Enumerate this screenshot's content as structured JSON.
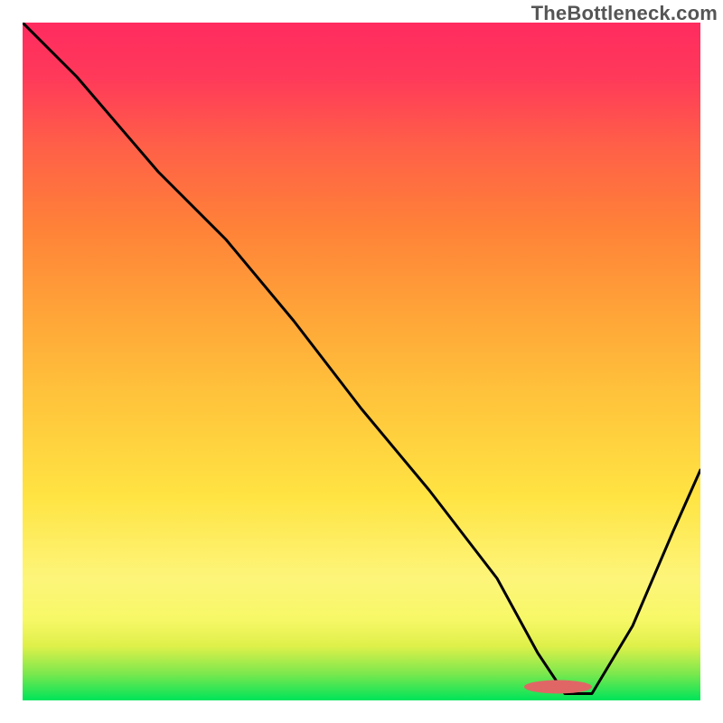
{
  "watermark": "TheBottleneck.com",
  "chart_data": {
    "type": "line",
    "title": "",
    "xlabel": "",
    "ylabel": "",
    "xlim": [
      0,
      100
    ],
    "ylim": [
      0,
      100
    ],
    "background": {
      "kind": "vertical-gradient",
      "description": "green at bottom through yellow/orange to pink at top",
      "stops": [
        {
          "pos": 0,
          "color": "#00e45a"
        },
        {
          "pos": 4,
          "color": "#7de84d"
        },
        {
          "pos": 8,
          "color": "#dff04a"
        },
        {
          "pos": 12,
          "color": "#f7f867"
        },
        {
          "pos": 18,
          "color": "#fdf57a"
        },
        {
          "pos": 30,
          "color": "#ffe443"
        },
        {
          "pos": 45,
          "color": "#ffc33b"
        },
        {
          "pos": 58,
          "color": "#ffa238"
        },
        {
          "pos": 70,
          "color": "#ff8138"
        },
        {
          "pos": 82,
          "color": "#ff5f48"
        },
        {
          "pos": 92,
          "color": "#ff395a"
        },
        {
          "pos": 100,
          "color": "#ff2b5f"
        }
      ]
    },
    "series": [
      {
        "name": "bottleneck-curve",
        "color": "#000000",
        "x": [
          0,
          8,
          20,
          30,
          40,
          50,
          60,
          70,
          76,
          80,
          84,
          90,
          96,
          100
        ],
        "y": [
          100,
          92,
          78,
          68,
          56,
          43,
          31,
          18,
          7,
          1,
          1,
          11,
          25,
          34
        ]
      }
    ],
    "marker": {
      "name": "optimal-range",
      "shape": "rounded-rect",
      "color": "#e06666",
      "x_range": [
        74,
        84
      ],
      "y": 1,
      "height": 2
    }
  }
}
